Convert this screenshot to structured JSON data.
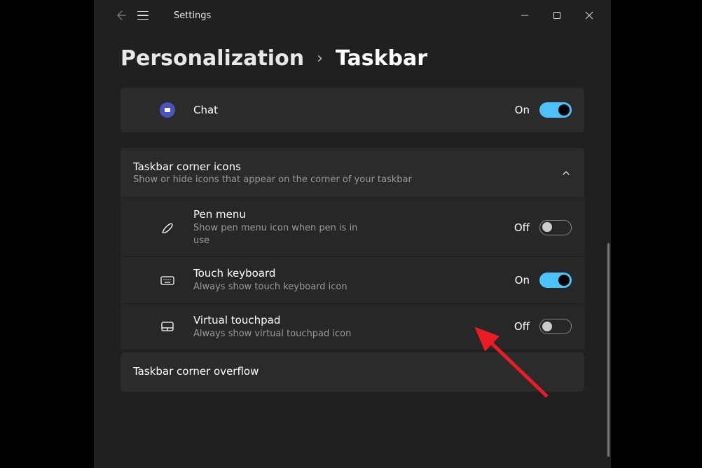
{
  "app": {
    "title": "Settings"
  },
  "breadcrumb": {
    "parent": "Personalization",
    "separator": "›",
    "current": "Taskbar"
  },
  "topItem": {
    "label": "Chat",
    "stateLabel": "On"
  },
  "section1": {
    "title": "Taskbar corner icons",
    "desc": "Show or hide icons that appear on the corner of your taskbar",
    "items": [
      {
        "title": "Pen menu",
        "desc": "Show pen menu icon when pen is in use",
        "stateLabel": "Off",
        "on": false
      },
      {
        "title": "Touch keyboard",
        "desc": "Always show touch keyboard icon",
        "stateLabel": "On",
        "on": true
      },
      {
        "title": "Virtual touchpad",
        "desc": "Always show virtual touchpad icon",
        "stateLabel": "Off",
        "on": false
      }
    ]
  },
  "section2": {
    "title": "Taskbar corner overflow"
  }
}
